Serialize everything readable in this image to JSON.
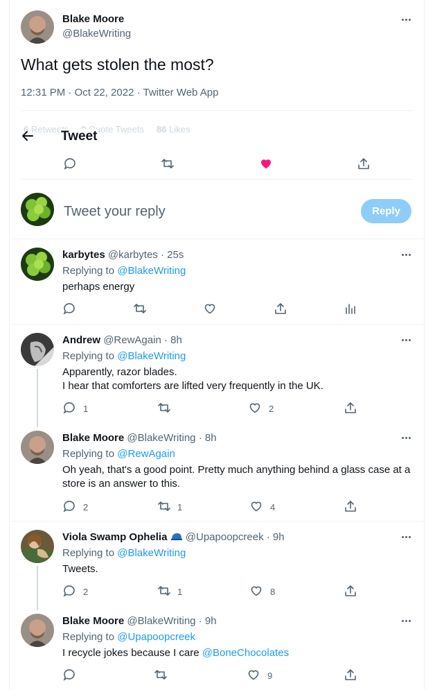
{
  "main_tweet": {
    "author_name": "Blake Moore",
    "author_handle": "@BlakeWriting",
    "text": "What gets stolen the most?",
    "meta": "12:31 PM · Oct 22, 2022 · Twitter Web App",
    "stats_retweets_num": "6",
    "stats_retweets_label": "Retweets",
    "stats_quotes_num": "9",
    "stats_quotes_label": "Quote Tweets",
    "stats_likes_num": "86",
    "stats_likes_label": "Likes"
  },
  "header": {
    "title": "Tweet"
  },
  "composer": {
    "placeholder": "Tweet your reply",
    "reply_label": "Reply"
  },
  "replies": [
    {
      "name": "karbytes",
      "handle": "@karbytes",
      "time": "· 25s",
      "replying_prefix": "Replying to",
      "replying_to": "@BlakeWriting",
      "text": "perhaps energy"
    },
    {
      "name": "Andrew",
      "handle": "@RewAgain",
      "time": "· 8h",
      "replying_prefix": "Replying to",
      "replying_to": "@BlakeWriting",
      "text1": "Apparently, razor blades.",
      "text2": "I hear that comforters are lifted very frequently in the UK.",
      "reply_count": "1",
      "like_count": "2"
    },
    {
      "name": "Blake Moore",
      "handle": "@BlakeWriting",
      "time": "· 8h",
      "replying_prefix": "Replying to",
      "replying_to": "@RewAgain",
      "text1": "Oh yeah, that's a good point. Pretty much anything behind a glass case at a",
      "text2": "store is an answer to this.",
      "reply_count": "2",
      "retweet_count": "1",
      "like_count": "4"
    },
    {
      "name": "Viola Swamp Ophelia",
      "handle": "@Upapoopcreek",
      "time": "· 9h",
      "replying_prefix": "Replying to",
      "replying_to": "@BlakeWriting",
      "text": "Tweets.",
      "reply_count": "2",
      "retweet_count": "1",
      "like_count": "8"
    },
    {
      "name": "Blake Moore",
      "handle": "@BlakeWriting",
      "time": "· 9h",
      "replying_prefix": "Replying to",
      "replying_to": "@Upapoopcreek",
      "text": "I recycle jokes because I care",
      "mention": "@BoneChocolates",
      "like_count": "9"
    }
  ],
  "colors": {
    "accent": "#1d9bf0",
    "like_active": "#f91880",
    "reply_button_bg": "#8ecdf8"
  }
}
